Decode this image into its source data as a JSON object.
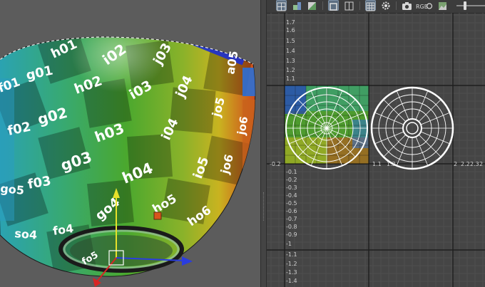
{
  "uv_editor": {
    "toolbar": {
      "buttons": [
        {
          "name": "uv-grid-toggle-button",
          "icon": "grid-icon",
          "active": true
        },
        {
          "name": "uv-shaded-button",
          "icon": "shaded-icon",
          "active": false
        },
        {
          "name": "uv-checker-button",
          "icon": "checker-icon",
          "active": false
        },
        {
          "name": "uv-texture-display-button",
          "icon": "texture-icon",
          "active": true
        },
        {
          "name": "uv-pixel-snap-button",
          "icon": "pixel-grid-icon",
          "active": false
        },
        {
          "name": "uv-grid-display-button",
          "icon": "grid-icon",
          "active": true
        },
        {
          "name": "uv-distortion-button",
          "icon": "gear-icon",
          "active": false
        },
        {
          "name": "uv-snapshot-button",
          "icon": "camera-icon",
          "active": false
        },
        {
          "name": "uv-rgb-channels-button",
          "icon": "rgb-icon",
          "active": false,
          "label": "RGB"
        },
        {
          "name": "uv-image-button",
          "icon": "image-icon",
          "active": false
        }
      ]
    },
    "axis_labels": {
      "top_v": [
        "1.7",
        "1.6",
        "1.5",
        "1.4",
        "1.3",
        "1.2",
        "1.1"
      ],
      "bottom_v": [
        "-0.1",
        "-0.2",
        "-0.3",
        "-0.4",
        "-0.5",
        "-0.6",
        "-0.7",
        "-0.8",
        "-0.9",
        "-1",
        "-1.1",
        "-1.2",
        "-1.3",
        "-1.4"
      ],
      "u_left": "-0.2",
      "u_right": [
        "1.1",
        "1.2",
        "2",
        "2.2",
        "2.3",
        "2"
      ]
    }
  },
  "viewport": {
    "texture_labels": [
      {
        "text": "h01"
      },
      {
        "text": "i02"
      },
      {
        "text": "j03"
      },
      {
        "text": "f01"
      },
      {
        "text": "g01"
      },
      {
        "text": "h02"
      },
      {
        "text": "i03"
      },
      {
        "text": "j04"
      },
      {
        "text": "a05"
      },
      {
        "text": "f02"
      },
      {
        "text": "g02"
      },
      {
        "text": "h03"
      },
      {
        "text": "i04"
      },
      {
        "text": "jo5"
      },
      {
        "text": "jo6"
      },
      {
        "text": "g03"
      },
      {
        "text": "h04"
      },
      {
        "text": "io5"
      },
      {
        "text": "jo6"
      },
      {
        "text": "f03"
      },
      {
        "text": "go4"
      },
      {
        "text": "ho5"
      },
      {
        "text": "ho6"
      },
      {
        "text": "fo4"
      },
      {
        "text": "go5"
      },
      {
        "text": "so4"
      },
      {
        "text": "fo5"
      }
    ]
  },
  "colors": {
    "viewport_bg": "#5c5c5c",
    "uv_bg": "#454545",
    "accent": "#5d6f82",
    "manip_x": "#d82424",
    "manip_y": "#e7e12a",
    "manip_z": "#2a3de0"
  }
}
